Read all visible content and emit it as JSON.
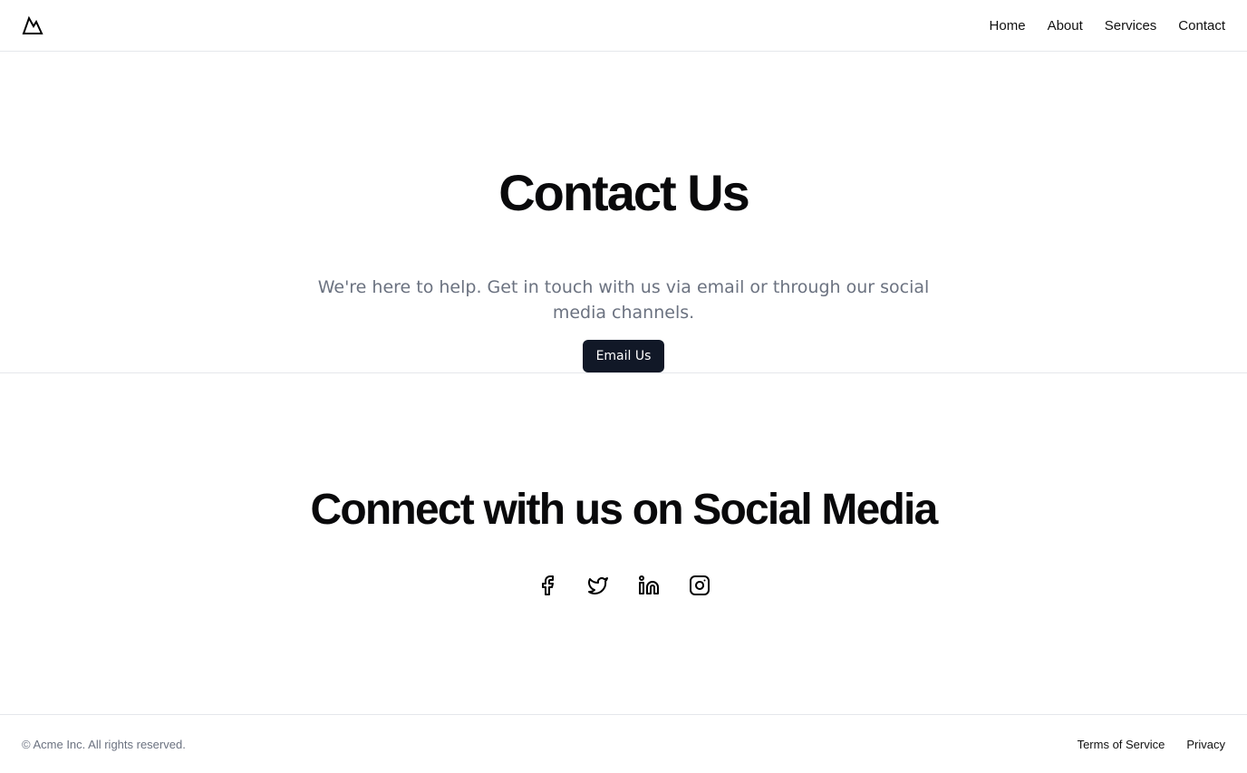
{
  "header": {
    "logo_icon": "mountain-icon",
    "nav": [
      "Home",
      "About",
      "Services",
      "Contact"
    ]
  },
  "hero": {
    "title": "Contact Us",
    "description": "We're here to help. Get in touch with us via email or through our social media channels.",
    "button_label": "Email Us"
  },
  "social": {
    "title": "Connect with us on Social Media",
    "icons": [
      "facebook-icon",
      "twitter-icon",
      "linkedin-icon",
      "instagram-icon"
    ]
  },
  "footer": {
    "copyright": "© Acme Inc. All rights reserved.",
    "links": [
      "Terms of Service",
      "Privacy"
    ]
  },
  "colors": {
    "button_bg": "#111827",
    "text_muted": "#6b7280",
    "border": "#e5e7eb"
  }
}
